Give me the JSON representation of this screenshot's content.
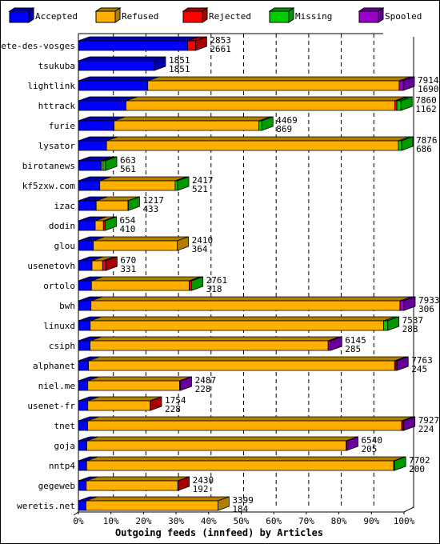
{
  "chart_data": {
    "type": "bar",
    "stacked": true,
    "orientation": "horizontal",
    "style": "3d",
    "xlabel": "Outgoing feeds (innfeed) by Articles",
    "xlim": [
      0,
      100
    ],
    "x_ticks": [
      "0%",
      "10%",
      "20%",
      "30%",
      "40%",
      "50%",
      "60%",
      "70%",
      "80%",
      "90%",
      "100%"
    ],
    "grid": true,
    "legend_position": "top",
    "categories": [
      "bete-des-vosges",
      "tsukuba",
      "lightlink",
      "httrack",
      "furie",
      "lysator",
      "birotanews",
      "kf5zxw.com",
      "izac",
      "dodin",
      "glou",
      "usenetovh",
      "ortolo",
      "bwh",
      "linuxd",
      "csiph",
      "alphanet",
      "niel.me",
      "usenet-fr",
      "tnet",
      "goja",
      "nntp4",
      "gegeweb",
      "weretis.net"
    ],
    "totals": [
      2853,
      1851,
      7914,
      7860,
      4469,
      7876,
      663,
      2417,
      1217,
      654,
      2410,
      670,
      2761,
      7933,
      7537,
      6145,
      7763,
      2487,
      1754,
      7927,
      6540,
      7702,
      2430,
      3399
    ],
    "series": [
      {
        "name": "Accepted",
        "color": "#0000ff",
        "top": "#0000aa",
        "values": [
          2661,
          1851,
          1690,
          1162,
          869,
          686,
          561,
          521,
          433,
          410,
          364,
          331,
          318,
          306,
          288,
          285,
          245,
          228,
          228,
          224,
          205,
          200,
          192,
          184
        ]
      },
      {
        "name": "Refused",
        "color": "#ffb000",
        "top": "#b07f00",
        "values": [
          0,
          0,
          6124,
          6548,
          3530,
          7110,
          40,
          1836,
          774,
          200,
          2046,
          260,
          2380,
          7527,
          7149,
          5800,
          7460,
          2240,
          1520,
          7650,
          6320,
          7480,
          2230,
          3215
        ]
      },
      {
        "name": "Rejected",
        "color": "#ff0000",
        "top": "#aa0000",
        "values": [
          192,
          0,
          0,
          50,
          0,
          0,
          0,
          0,
          0,
          40,
          0,
          79,
          60,
          0,
          0,
          0,
          30,
          0,
          6,
          30,
          0,
          0,
          8,
          0
        ]
      },
      {
        "name": "Missing",
        "color": "#00cc00",
        "top": "#009900",
        "values": [
          0,
          0,
          0,
          100,
          70,
          80,
          62,
          60,
          10,
          4,
          0,
          0,
          3,
          0,
          100,
          0,
          0,
          0,
          0,
          0,
          0,
          22,
          0,
          0
        ]
      },
      {
        "name": "Spooled",
        "color": "#9900cc",
        "top": "#660099",
        "values": [
          0,
          0,
          100,
          0,
          0,
          0,
          0,
          0,
          0,
          0,
          0,
          0,
          0,
          100,
          0,
          60,
          28,
          19,
          0,
          23,
          15,
          0,
          0,
          0
        ]
      }
    ]
  }
}
